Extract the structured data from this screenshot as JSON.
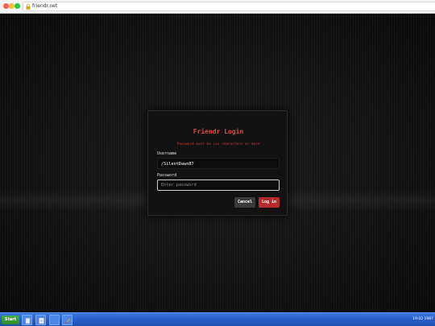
{
  "browser": {
    "url": "friendr.net",
    "icons": [
      "close-dot-icon",
      "minimize-dot-icon",
      "zoom-dot-icon",
      "lock-icon"
    ]
  },
  "dialog": {
    "title": "Friendr Login",
    "error": "Password must be six characters or more",
    "username_label": "Username",
    "username_value": "/SilentDawn87",
    "password_label": "Password",
    "password_placeholder": "Enter password",
    "cancel_label": "Cancel",
    "login_label": "Log in"
  },
  "taskbar": {
    "start_label": "Start",
    "clock": "19:02 1987",
    "icons": [
      "recycle-bin-icon",
      "notepad-icon",
      "blank-window-icon",
      "paint-icon"
    ]
  },
  "colors": {
    "accent": "#e04848",
    "error": "#c13a3a",
    "login_button": "#b52a2a",
    "cancel_button": "#3a3a3a",
    "taskbar": "#2a62cc"
  }
}
